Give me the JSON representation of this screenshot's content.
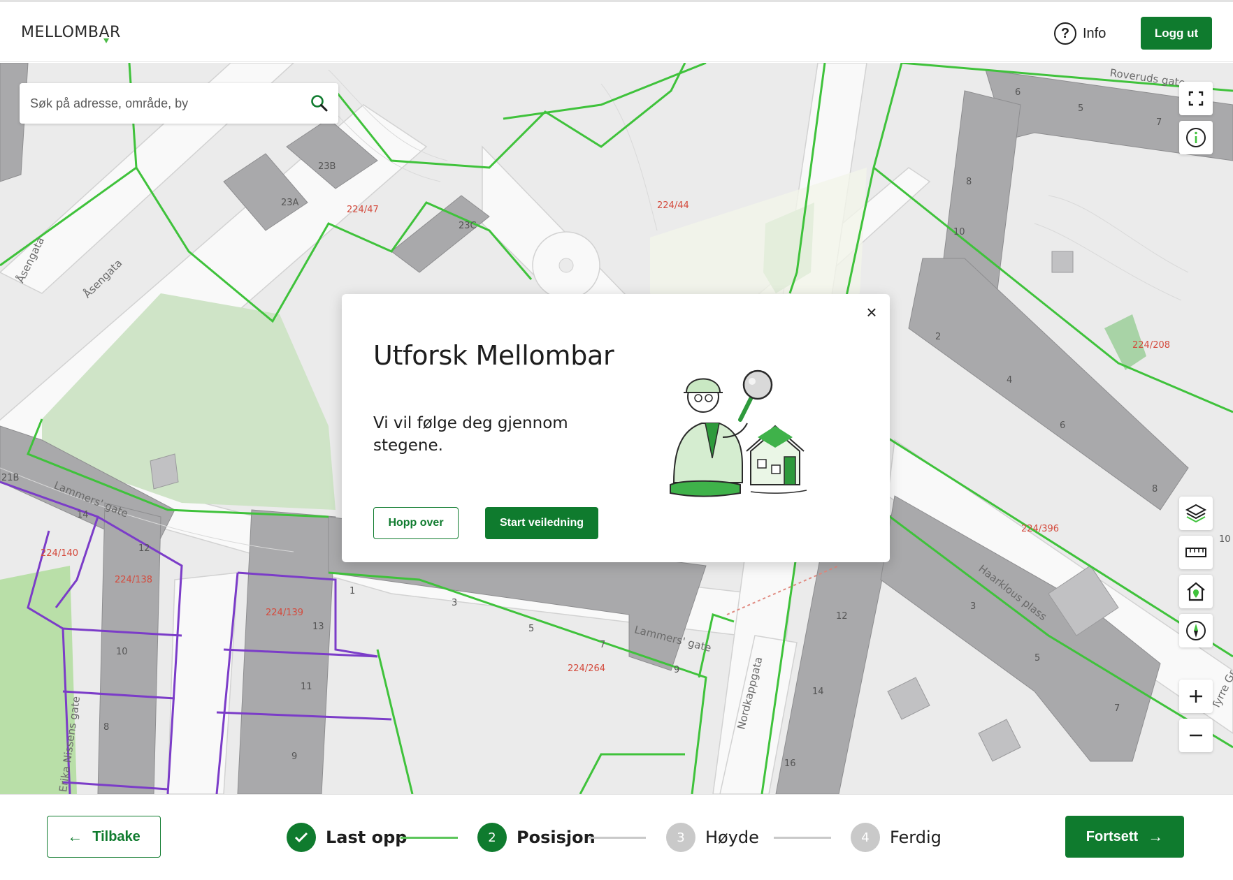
{
  "header": {
    "logo": "MELLOMBAR",
    "info_label": "Info",
    "logout_label": "Logg ut"
  },
  "search": {
    "placeholder": "Søk på adresse, område, by"
  },
  "map": {
    "parcels": [
      "224/47",
      "224/44",
      "224/208",
      "224/396",
      "224/140",
      "224/138",
      "224/139",
      "224/264"
    ],
    "streets": [
      "Roveruds gate",
      "Åsengata",
      "Åsengata",
      "Lammers' gate",
      "Lammers' gate",
      "Haarklous plass",
      "Nordkappgata",
      "Erika Nissens gate",
      "Tyrre Gr"
    ],
    "addresses": [
      "23B",
      "23A",
      "23C",
      "6",
      "5",
      "7",
      "8",
      "10",
      "2",
      "4",
      "6",
      "8",
      "10",
      "21B",
      "14",
      "12",
      "10",
      "8",
      "1",
      "3",
      "5",
      "7",
      "9",
      "13",
      "11",
      "9",
      "12",
      "14",
      "16",
      "3",
      "5",
      "7"
    ],
    "controls": [
      "fullscreen-icon",
      "info-icon",
      "layers-icon",
      "ruler-icon",
      "home-marker-icon",
      "compass-icon",
      "zoom-in-icon",
      "zoom-out-icon"
    ],
    "colors": {
      "parcel_green": "#3fc23b",
      "parcel_purple": "#7b3cc8",
      "building": "#a9a9ab",
      "road": "#f8f8f8",
      "park": "#cfe6c7"
    }
  },
  "dialog": {
    "title": "Utforsk Mellombar",
    "text": "Vi vil følge deg gjennom stegene.",
    "skip_label": "Hopp over",
    "start_label": "Start veiledning",
    "close": "×"
  },
  "footer": {
    "back_label": "Tilbake",
    "next_label": "Fortsett",
    "steps": [
      {
        "number": "1",
        "label": "Last opp",
        "state": "done"
      },
      {
        "number": "2",
        "label": "Posisjon",
        "state": "active"
      },
      {
        "number": "3",
        "label": "Høyde",
        "state": "todo"
      },
      {
        "number": "4",
        "label": "Ferdig",
        "state": "todo"
      }
    ]
  },
  "colors": {
    "brand_green": "#0f7b2e",
    "step_line_green": "#5bc55a",
    "step_todo": "#c9c9c9"
  }
}
